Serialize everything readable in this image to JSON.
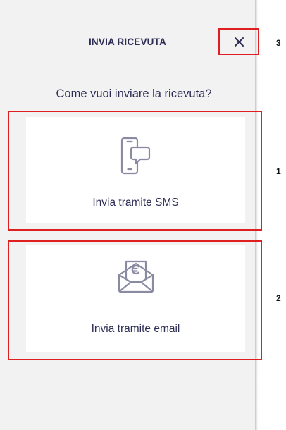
{
  "dialog": {
    "title": "INVIA RICEVUTA",
    "question": "Come vuoi inviare la ricevuta?"
  },
  "options": [
    {
      "label": "Invia tramite SMS",
      "icon": "phone-sms-icon"
    },
    {
      "label": "Invia tramite email",
      "icon": "envelope-euro-icon"
    }
  ],
  "markers": [
    "1",
    "2",
    "3"
  ],
  "colors": {
    "panel_bg": "#f2f2f2",
    "card_bg": "#ffffff",
    "text": "#2d2c55",
    "icon": "#8a8ba3",
    "highlight": "#e02020"
  }
}
